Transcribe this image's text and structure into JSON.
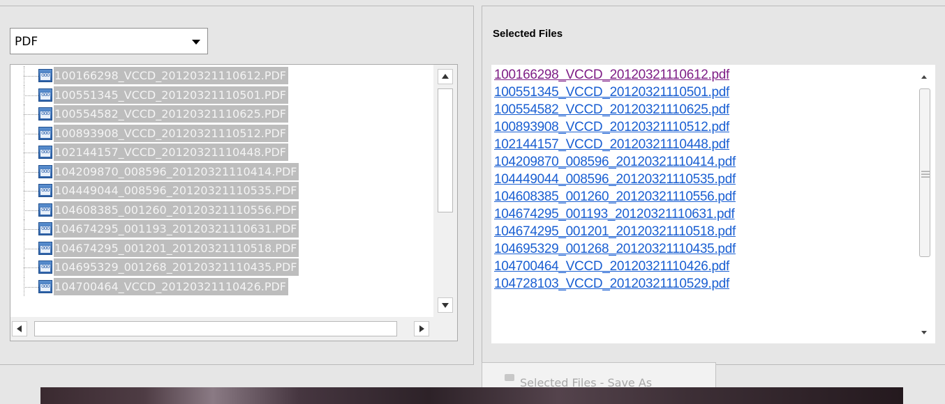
{
  "filter": {
    "selected": "PDF"
  },
  "tree_files": [
    "100166298_VCCD_20120321110612.PDF",
    "100551345_VCCD_20120321110501.PDF",
    "100554582_VCCD_20120321110625.PDF",
    "100893908_VCCD_20120321110512.PDF",
    "102144157_VCCD_20120321110448.PDF",
    "104209870_008596_20120321110414.PDF",
    "104449044_008596_20120321110535.PDF",
    "104608385_001260_20120321110556.PDF",
    "104674295_001193_20120321110631.PDF",
    "104674295_001201_20120321110518.PDF",
    "104695329_001268_20120321110435.PDF",
    "104700464_VCCD_20120321110426.PDF"
  ],
  "selected_files": {
    "title": "Selected Files",
    "items": [
      "100166298_VCCD_20120321110612.pdf",
      "100551345_VCCD_20120321110501.pdf",
      "100554582_VCCD_20120321110625.pdf",
      "100893908_VCCD_20120321110512.pdf",
      "102144157_VCCD_20120321110448.pdf",
      "104209870_008596_20120321110414.pdf",
      "104449044_008596_20120321110535.pdf",
      "104608385_001260_20120321110556.pdf",
      "104674295_001193_20120321110631.pdf",
      "104674295_001201_20120321110518.pdf",
      "104695329_001268_20120321110435.pdf",
      "104700464_VCCD_20120321110426.pdf",
      "104728103_VCCD_20120321110529.pdf"
    ],
    "visited_index": 0
  },
  "save_as_button": {
    "label": "Selected Files - Save As"
  },
  "colors": {
    "link": "#1a5fd2",
    "visited_link": "#7e1e86",
    "tree_selection": "#bdbdbd",
    "panel_bg": "#e6e6e6"
  },
  "icons": [
    "pdf-file-icon",
    "save-icon",
    "dropdown-arrow-icon",
    "scroll-up-icon",
    "scroll-down-icon",
    "scroll-left-icon",
    "scroll-right-icon"
  ]
}
